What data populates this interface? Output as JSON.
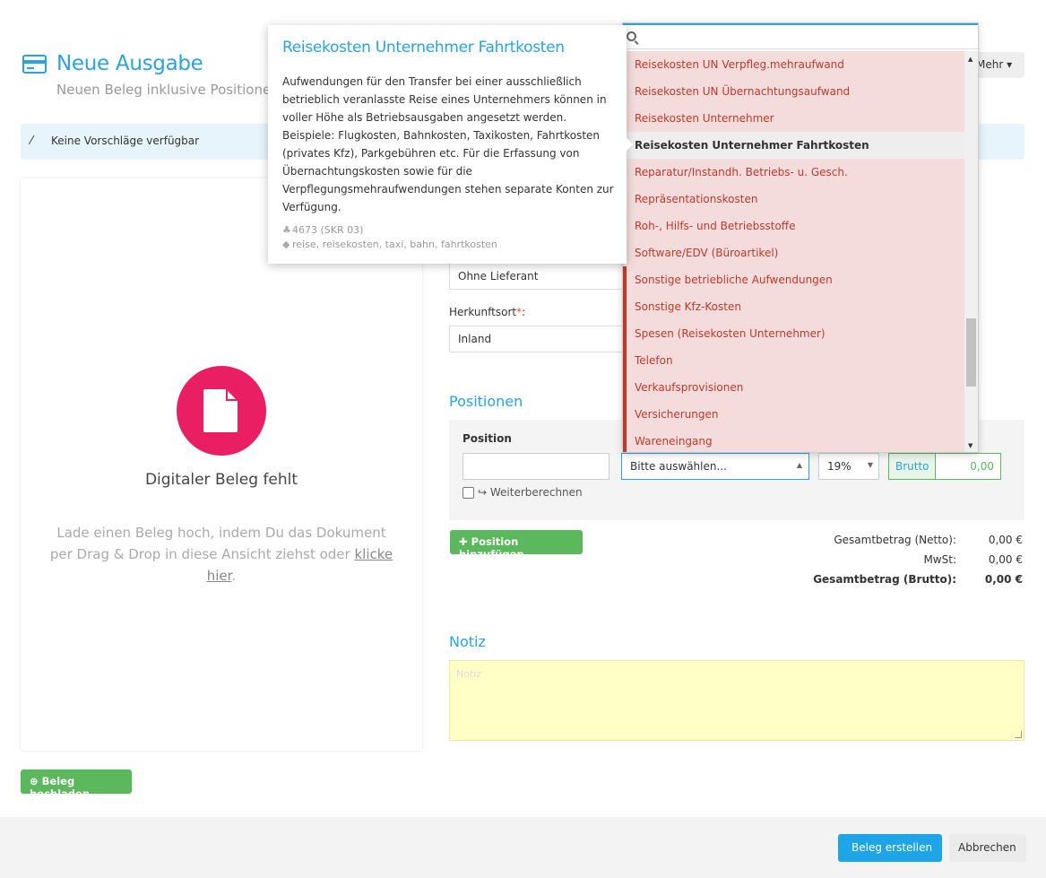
{
  "header": {
    "title": "Neue Ausgabe",
    "subtitle": "Neuen Beleg inklusive Positionen",
    "more_label": "Mehr ▾"
  },
  "alert": {
    "text": "Keine Vorschläge verfügbar"
  },
  "document": {
    "title": "Digitaler Beleg fehlt",
    "hint": "Lade einen Beleg hoch, indem Du das Dokument per Drag & Drop in diese Ansicht ziehst oder",
    "hint_link": "klicke hier",
    "hint_end": ".",
    "upload_label": "Beleg hochladen"
  },
  "form": {
    "lieferant_value": "Ohne Lieferant",
    "herkunft_label": "Herkunftsort",
    "herkunft_required": "*",
    "herkunft_colon": ":",
    "herkunft_value": "Inland"
  },
  "positions": {
    "section_title": "Positionen",
    "position_label": "Position",
    "category_placeholder": "Bitte auswählen...",
    "vat_value": "19%",
    "brutto_label": "Brutto",
    "brutto_value": "0,00",
    "weiter_label": "Weiterberechnen",
    "add_label": "Position hinzufügen"
  },
  "totals": {
    "netto_label": "Gesamtbetrag (Netto):",
    "netto_value": "0,00 €",
    "mwst_label": "MwSt:",
    "mwst_value": "0,00 €",
    "brutto_label": "Gesamtbetrag (Brutto):",
    "brutto_value": "0,00 €"
  },
  "notiz": {
    "section_title": "Notiz",
    "placeholder": "Notiz"
  },
  "footer": {
    "create_label": "Beleg erstellen",
    "cancel_label": "Abbrechen"
  },
  "dropdown": {
    "items": [
      "Reisekosten UN Verpfleg.mehraufwand",
      "Reisekosten UN Übernachtungsaufwand",
      "Reisekosten Unternehmer",
      "Reisekosten Unternehmer Fahrtkosten",
      "Reparatur/Instandh. Betriebs- u. Gesch.",
      "Repräsentationskosten",
      "Roh-, Hilfs- und Betriebsstoffe",
      "Software/EDV (Büroartikel)",
      "Sonstige betriebliche Aufwendungen",
      "Sonstige Kfz-Kosten",
      "Spesen (Reisekosten Unternehmer)",
      "Telefon",
      "Verkaufsprovisionen",
      "Versicherungen",
      "Wareneingang"
    ]
  },
  "tooltip": {
    "title": "Reisekosten Unternehmer Fahrtkosten",
    "body": "Aufwendungen für den Transfer bei einer ausschließlich betrieblich veranlasste Reise eines Unternehmers können in voller Höhe als Betriebsausgaben angesetzt werden. Beispiele: Flugkosten, Bahnkosten, Taxikosten, Fahrtkosten (privates Kfz), Parkgebühren etc. Für die Erfassung von Übernachtungskosten sowie für die Verpflegungsmehraufwendungen stehen separate Konten zur Verfügung.",
    "account": "4673 (SKR 03)",
    "tags": "reise, reisekosten, taxi, bahn, fahrtkosten"
  },
  "colors": {
    "primary": "#2aa3e0",
    "success": "#5cb85c",
    "danger": "#c0392b",
    "doc_icon": "#e91e63"
  }
}
